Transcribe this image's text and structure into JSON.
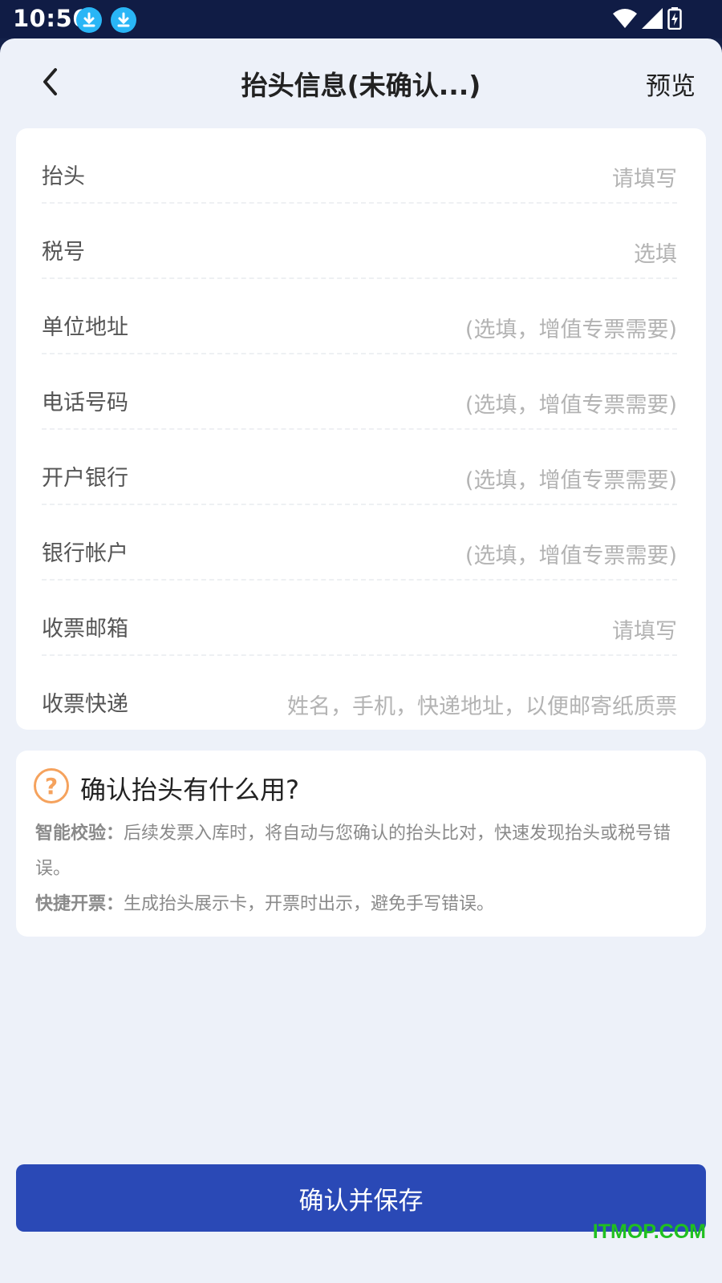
{
  "status_bar": {
    "time": "10:56"
  },
  "nav": {
    "title": "抬头信息(未确认...)",
    "preview": "预览"
  },
  "form": {
    "fields": [
      {
        "label": "抬头",
        "placeholder": "请填写"
      },
      {
        "label": "税号",
        "placeholder": "选填"
      },
      {
        "label": "单位地址",
        "placeholder": "(选填，增值专票需要)"
      },
      {
        "label": "电话号码",
        "placeholder": "(选填，增值专票需要)"
      },
      {
        "label": "开户银行",
        "placeholder": "(选填，增值专票需要)"
      },
      {
        "label": "银行帐户",
        "placeholder": "(选填，增值专票需要)"
      },
      {
        "label": "收票邮箱",
        "placeholder": "请填写"
      },
      {
        "label": "收票快递",
        "placeholder": "姓名，手机，快递地址，以便邮寄纸质票"
      }
    ]
  },
  "info": {
    "icon": "?",
    "title": "确认抬头有什么用?",
    "item1_label": "智能校验：",
    "item1_text": "后续发票入库时，将自动与您确认的抬头比对，快速发现抬头或税号错误。",
    "item2_label": "快捷开票：",
    "item2_text": "生成抬头展示卡，开票时出示，避免手写错误。"
  },
  "confirm_button": "确认并保存",
  "watermark": "ITMOP.COM"
}
